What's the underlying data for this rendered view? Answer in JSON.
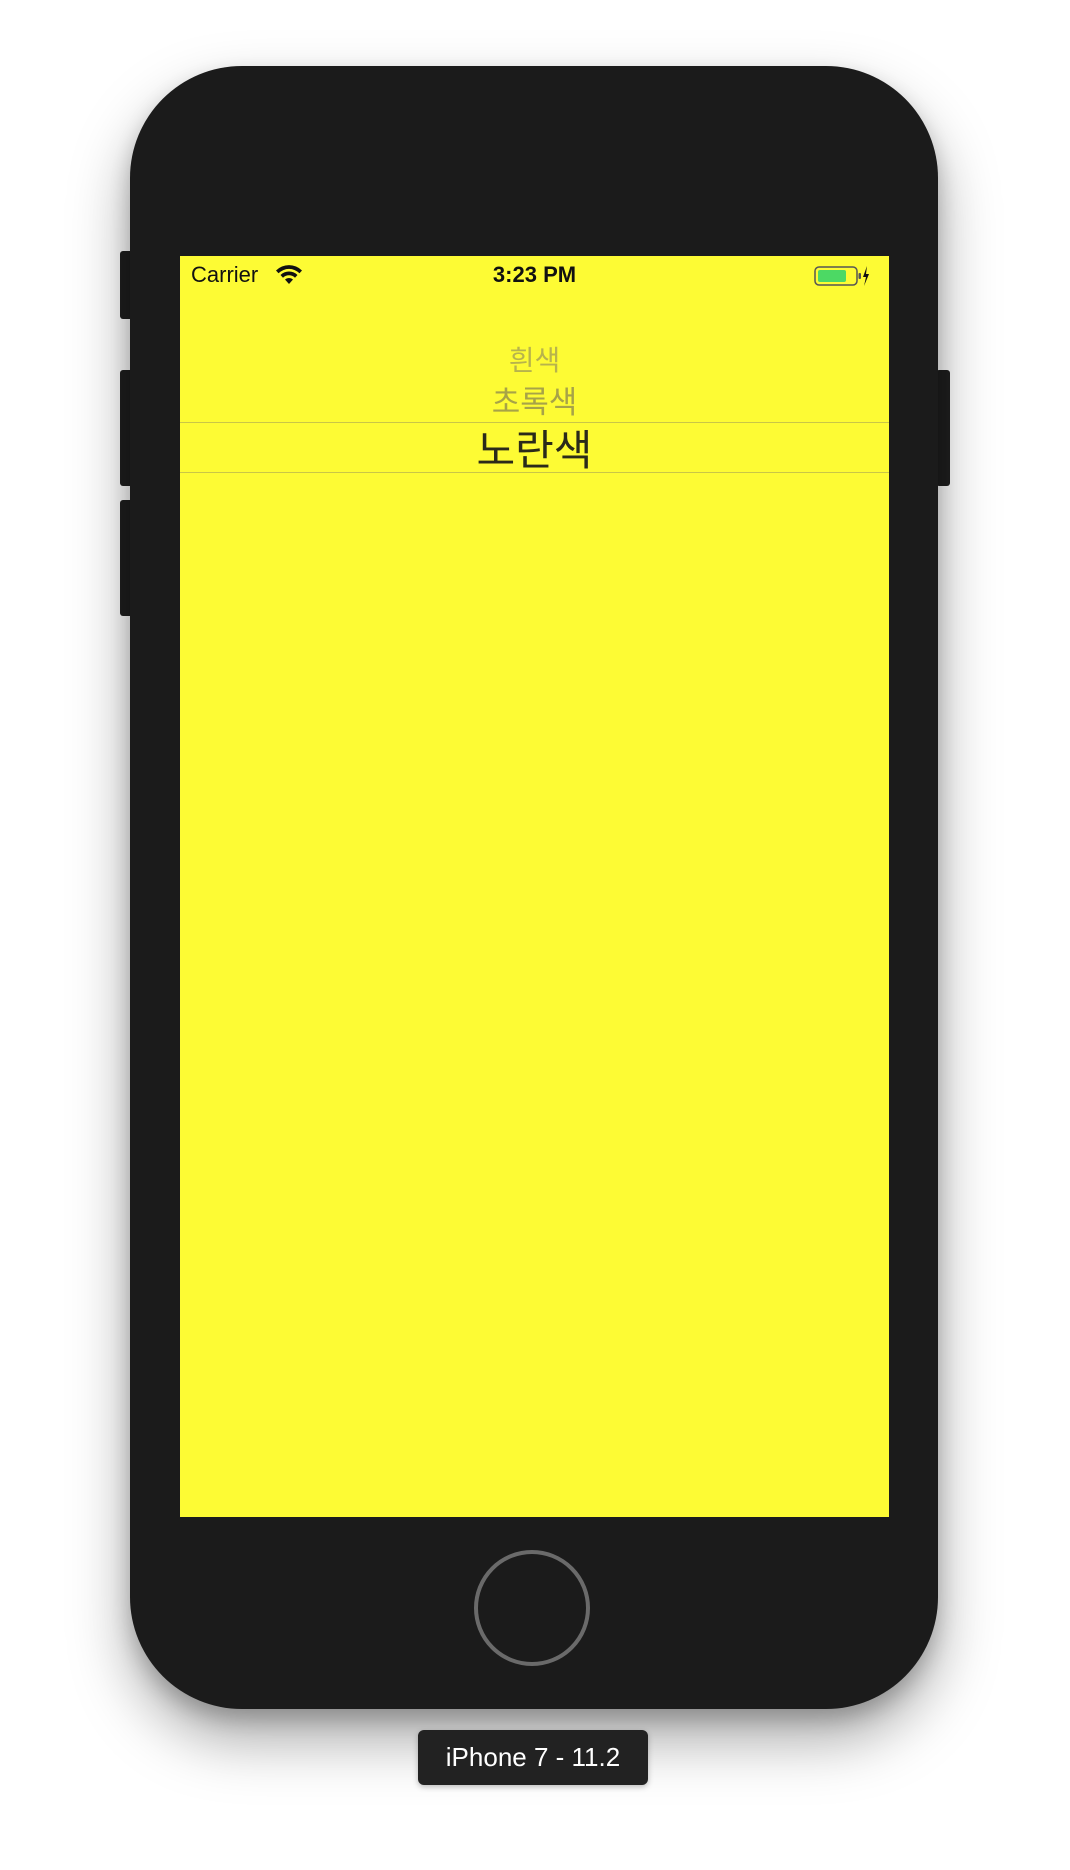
{
  "status_bar": {
    "carrier": "Carrier",
    "time": "3:23 PM",
    "icons": [
      "wifi-icon",
      "battery-charging-icon"
    ]
  },
  "picker": {
    "rows": [
      "흰색",
      "초록색",
      "노란색"
    ],
    "selected": "노란색"
  },
  "device": {
    "label": "iPhone 7 - 11.2"
  },
  "colors": {
    "screen_background": "#fdfb34",
    "device_body": "#1b1b1b",
    "battery_fill": "#4cd964"
  }
}
